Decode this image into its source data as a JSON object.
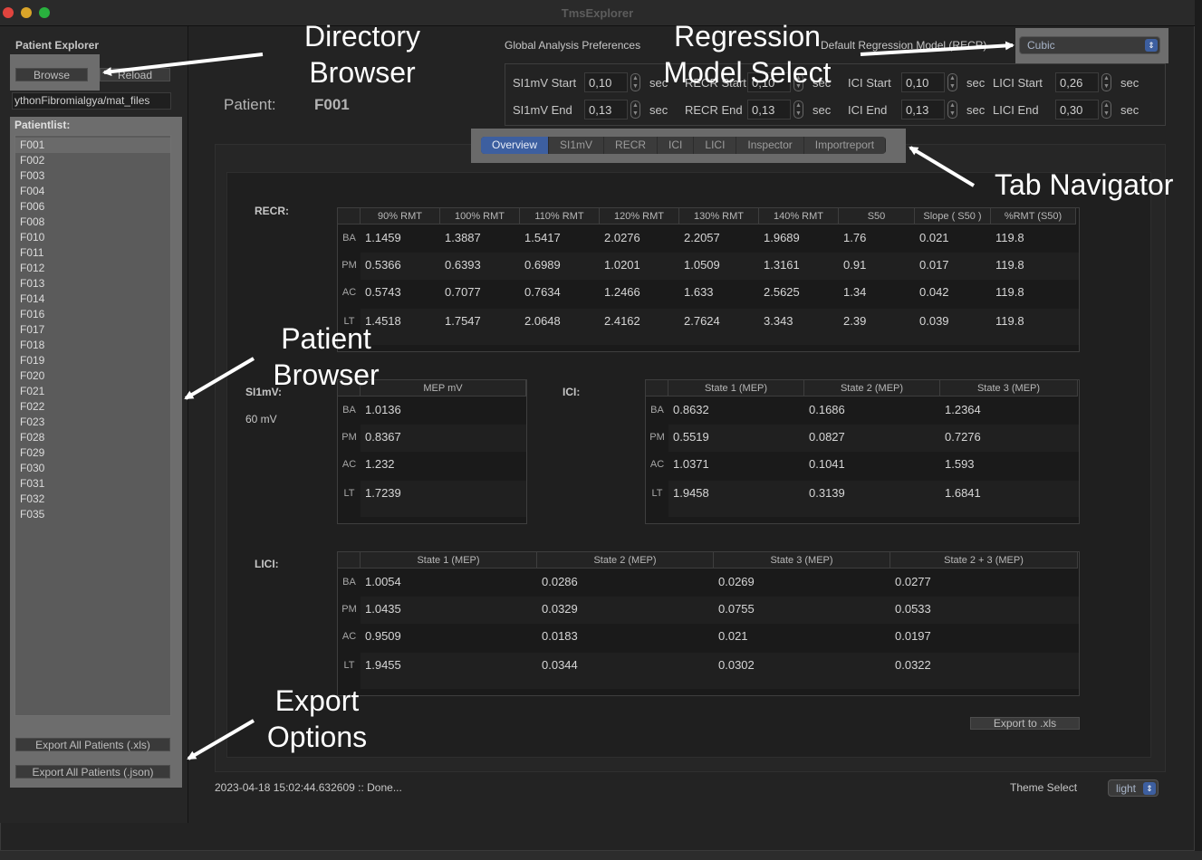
{
  "window": {
    "title": "TmsExplorer"
  },
  "sidebar": {
    "header": "Patient Explorer",
    "browse_label": "Browse",
    "reload_label": "Reload",
    "path_value": "ythonFibromialgya/mat_files",
    "patientlist_label": "Patientlist:",
    "patients": [
      "F001",
      "F002",
      "F003",
      "F004",
      "F006",
      "F008",
      "F010",
      "F011",
      "F012",
      "F013",
      "F014",
      "F016",
      "F017",
      "F018",
      "F019",
      "F020",
      "F021",
      "F022",
      "F023",
      "F028",
      "F029",
      "F030",
      "F031",
      "F032",
      "F035"
    ],
    "export_xls_label": "Export All Patients (.xls)",
    "export_json_label": "Export All Patients (.json)"
  },
  "header": {
    "patient_label": "Patient:",
    "patient_id": "F001",
    "global_pref_label": "Global Analysis Preferences",
    "default_model_label": "Default Regression Model (RECR)",
    "model_value": "Cubic",
    "unit": "sec",
    "params": [
      {
        "label": "SI1mV Start",
        "value": "0,10"
      },
      {
        "label": "SI1mV End",
        "value": "0,13"
      },
      {
        "label": "RECR Start",
        "value": "0,10"
      },
      {
        "label": "RECR End",
        "value": "0,13"
      },
      {
        "label": "ICI Start",
        "value": "0,10"
      },
      {
        "label": "ICI End",
        "value": "0,13"
      },
      {
        "label": "LICI Start",
        "value": "0,26"
      },
      {
        "label": "LICI End",
        "value": "0,30"
      }
    ]
  },
  "tabs": [
    "Overview",
    "SI1mV",
    "RECR",
    "ICI",
    "LICI",
    "Inspector",
    "Importreport"
  ],
  "recr": {
    "label": "RECR:",
    "columns": [
      "90% RMT",
      "100% RMT",
      "110% RMT",
      "120% RMT",
      "130% RMT",
      "140% RMT",
      "S50",
      "Slope ( S50 )",
      "%RMT (S50)"
    ],
    "rows": [
      {
        "name": "BA",
        "values": [
          "1.1459",
          "1.3887",
          "1.5417",
          "2.0276",
          "2.2057",
          "1.9689",
          "1.76",
          "0.021",
          "119.8"
        ]
      },
      {
        "name": "PM",
        "values": [
          "0.5366",
          "0.6393",
          "0.6989",
          "1.0201",
          "1.0509",
          "1.3161",
          "0.91",
          "0.017",
          "119.8"
        ]
      },
      {
        "name": "AC",
        "values": [
          "0.5743",
          "0.7077",
          "0.7634",
          "1.2466",
          "1.633",
          "2.5625",
          "1.34",
          "0.042",
          "119.8"
        ]
      },
      {
        "name": "LT",
        "values": [
          "1.4518",
          "1.7547",
          "2.0648",
          "2.4162",
          "2.7624",
          "3.343",
          "2.39",
          "0.039",
          "119.8"
        ]
      }
    ]
  },
  "si1mv": {
    "label": "SI1mV:",
    "value": "60 mV",
    "columns": [
      "MEP mV"
    ],
    "rows": [
      {
        "name": "BA",
        "values": [
          "1.0136"
        ]
      },
      {
        "name": "PM",
        "values": [
          "0.8367"
        ]
      },
      {
        "name": "AC",
        "values": [
          "1.232"
        ]
      },
      {
        "name": "LT",
        "values": [
          "1.7239"
        ]
      }
    ]
  },
  "ici": {
    "label": "ICI:",
    "columns": [
      "State 1 (MEP)",
      "State 2 (MEP)",
      "State 3 (MEP)"
    ],
    "rows": [
      {
        "name": "BA",
        "values": [
          "0.8632",
          "0.1686",
          "1.2364"
        ]
      },
      {
        "name": "PM",
        "values": [
          "0.5519",
          "0.0827",
          "0.7276"
        ]
      },
      {
        "name": "AC",
        "values": [
          "1.0371",
          "0.1041",
          "1.593"
        ]
      },
      {
        "name": "LT",
        "values": [
          "1.9458",
          "0.3139",
          "1.6841"
        ]
      }
    ]
  },
  "lici": {
    "label": "LICI:",
    "columns": [
      "State 1 (MEP)",
      "State 2 (MEP)",
      "State 3 (MEP)",
      "State 2 + 3 (MEP)"
    ],
    "rows": [
      {
        "name": "BA",
        "values": [
          "1.0054",
          "0.0286",
          "0.0269",
          "0.0277"
        ]
      },
      {
        "name": "PM",
        "values": [
          "1.0435",
          "0.0329",
          "0.0755",
          "0.0533"
        ]
      },
      {
        "name": "AC",
        "values": [
          "0.9509",
          "0.0183",
          "0.021",
          "0.0197"
        ]
      },
      {
        "name": "LT",
        "values": [
          "1.9455",
          "0.0344",
          "0.0302",
          "0.0322"
        ]
      }
    ]
  },
  "export_xls_label": "Export to .xls",
  "status": "2023-04-18 15:02:44.632609 :: Done...",
  "theme": {
    "label": "Theme Select",
    "value": "light"
  },
  "annotations": {
    "directory_browser": [
      "Directory",
      "Browser"
    ],
    "regression_model": [
      "Regression",
      "Model Select"
    ],
    "tab_navigator": "Tab Navigator",
    "patient_browser": [
      "Patient",
      "Browser"
    ],
    "export_options": [
      "Export",
      "Options"
    ]
  },
  "colors": {
    "accent": "#3d5fa0",
    "background": "#232323",
    "annotation": "#ffffff"
  }
}
